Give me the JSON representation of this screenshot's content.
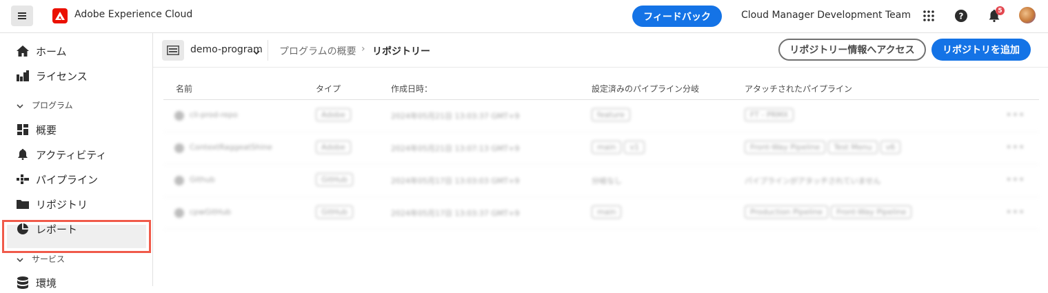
{
  "topbar": {
    "brand": "Adobe Experience Cloud",
    "feedback_label": "フィードバック",
    "team": "Cloud Manager Development Team",
    "notification_count": "5"
  },
  "sidebar": {
    "items": [
      {
        "label": "ホーム",
        "icon": "home-icon"
      },
      {
        "label": "ライセンス",
        "icon": "license-icon"
      }
    ],
    "section_program": "プログラム",
    "program_items": [
      {
        "label": "概要",
        "icon": "overview-icon"
      },
      {
        "label": "アクティビティ",
        "icon": "bell-icon"
      },
      {
        "label": "パイプライン",
        "icon": "pipeline-icon"
      },
      {
        "label": "リポジトリ",
        "icon": "folder-icon",
        "selected": true
      },
      {
        "label": "レポート",
        "icon": "report-icon"
      }
    ],
    "section_services": "サービス",
    "service_items": [
      {
        "label": "環境",
        "icon": "database-icon"
      }
    ]
  },
  "breadcrumb": {
    "program": "demo-program",
    "crumb1": "プログラムの概要",
    "separator": "›",
    "current": "リポジトリー"
  },
  "actions": {
    "access_info": "リポジトリー情報へアクセス",
    "add_repo": "リポジトリを追加"
  },
  "table": {
    "headers": [
      "名前",
      "タイプ",
      "作成日時：",
      "設定済みのパイプライン分岐",
      "アタッチされたパイプライン"
    ],
    "rows": [
      {
        "name": "cli-prod-repo",
        "type": "Adobe",
        "created": "2024年05月21日 13:03:37 GMT+9",
        "branches": [
          "feature"
        ],
        "pipelines": [
          "FT - PRMX"
        ]
      },
      {
        "name": "ContextRaggeatShine",
        "type": "Adobe",
        "created": "2024年05月21日 13:07:13 GMT+9",
        "branches": [
          "main",
          "v1"
        ],
        "pipelines": [
          "Front-Way Pipeline",
          "Test Menu",
          "v6"
        ]
      },
      {
        "name": "Github",
        "type": "GitHub",
        "created": "2024年05月17日 13:03:03 GMT+9",
        "branches_text": "分岐なし",
        "pipelines_text": "パイプラインがアタッチされていません"
      },
      {
        "name": "cpwGitHub",
        "type": "GitHub",
        "created": "2024年05月17日 13:03:37 GMT+9",
        "branches": [
          "main"
        ],
        "pipelines": [
          "Production Pipeline",
          "Front-Way Pipeline"
        ]
      }
    ],
    "more_label": "•••"
  }
}
